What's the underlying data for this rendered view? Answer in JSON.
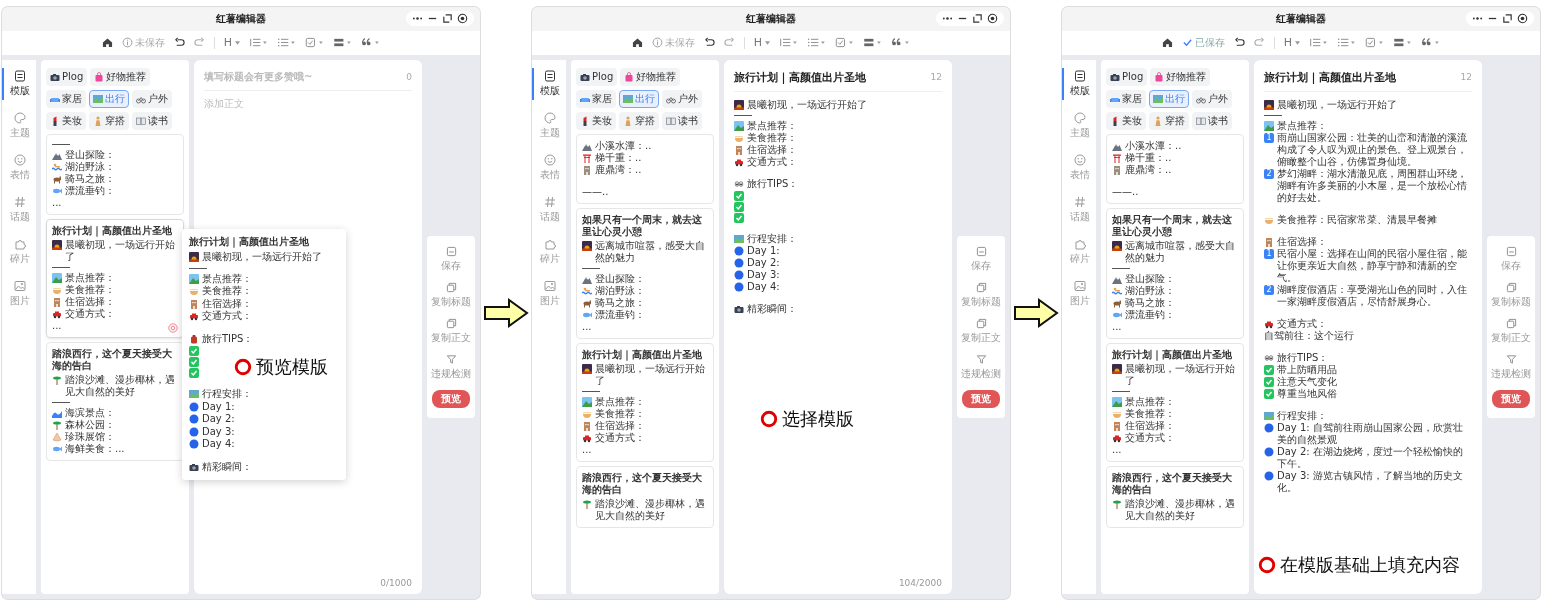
{
  "steps": [
    {
      "window_title": "红薯编辑器",
      "save_status": {
        "text": "未保存",
        "saved": false
      },
      "heading_label": "H",
      "nav": [
        {
          "label": "模版",
          "selected": true
        },
        {
          "label": "主题",
          "selected": false
        },
        {
          "label": "表情",
          "selected": false
        },
        {
          "label": "话题",
          "selected": false
        },
        {
          "label": "碎片",
          "selected": false
        },
        {
          "label": "图片",
          "selected": false
        }
      ],
      "category_rows": [
        [
          {
            "kind": "camera",
            "label": "Plog",
            "selected": false
          },
          {
            "kind": "shop",
            "label": "好物推荐",
            "selected": false
          }
        ],
        [
          {
            "kind": "sofa",
            "label": "家居",
            "selected": false
          },
          {
            "kind": "map",
            "label": "出行",
            "selected": true
          },
          {
            "kind": "bike",
            "label": "户外",
            "selected": false
          }
        ],
        [
          {
            "kind": "lipstick",
            "label": "美妆",
            "selected": false
          },
          {
            "kind": "person",
            "label": "穿搭",
            "selected": false
          },
          {
            "kind": "book",
            "label": "读书",
            "selected": false
          }
        ]
      ],
      "cards": [
        {
          "hovered": false,
          "lines": [
            {
              "kind": "rule"
            },
            {
              "kind": "hike",
              "text": "登山探险："
            },
            {
              "kind": "swim",
              "text": "湖泊野泳："
            },
            {
              "kind": "horse",
              "text": "骑马之旅："
            },
            {
              "kind": "fish",
              "text": "漂流垂钓："
            },
            {
              "kind": "plain",
              "text": "..."
            }
          ]
        },
        {
          "title": "旅行计划｜高颜值出片圣地",
          "hovered": true,
          "lines": [
            {
              "kind": "sunrise",
              "text": "晨曦初现，一场远行开始了"
            },
            {
              "kind": "rule"
            },
            {
              "kind": "scenery",
              "text": "景点推荐："
            },
            {
              "kind": "food",
              "text": "美食推荐："
            },
            {
              "kind": "hotel",
              "text": "住宿选择："
            },
            {
              "kind": "car",
              "text": "交通方式："
            },
            {
              "kind": "plain",
              "text": "..."
            }
          ]
        },
        {
          "title": "踏浪西行，这个夏天接受大海的告白",
          "hovered": false,
          "lines": [
            {
              "kind": "palm",
              "text": "踏浪沙滩、漫步椰林，遇见大自然的美好"
            },
            {
              "kind": "rule"
            },
            {
              "kind": "wave",
              "text": "海滨景点："
            },
            {
              "kind": "palm",
              "text": "森林公园："
            },
            {
              "kind": "shell",
              "text": "珍珠展馆："
            },
            {
              "kind": "fish",
              "text": "海鲜美食：..."
            }
          ]
        }
      ],
      "editor": {
        "title_placeholder": "填写标题会有更多赞哦~",
        "title_count": "0",
        "body_placeholder": "添加正文",
        "counter": "0/1000"
      },
      "preview": {
        "title": "旅行计划｜高颜值出片圣地",
        "lines": [
          {
            "kind": "sunrise",
            "text": "晨曦初现，一场远行开始了"
          },
          {
            "kind": "rule"
          },
          {
            "kind": "scenery",
            "text": "景点推荐："
          },
          {
            "kind": "food",
            "text": "美食推荐："
          },
          {
            "kind": "hotel",
            "text": "住宿选择："
          },
          {
            "kind": "car",
            "text": "交通方式："
          },
          {
            "kind": "blank"
          },
          {
            "kind": "bag",
            "text": "旅行TIPS："
          },
          {
            "kind": "check"
          },
          {
            "kind": "check"
          },
          {
            "kind": "check"
          },
          {
            "kind": "blank"
          },
          {
            "kind": "map",
            "text": "行程安排："
          },
          {
            "kind": "day",
            "text": "Day 1:"
          },
          {
            "kind": "day",
            "text": "Day 2:"
          },
          {
            "kind": "day",
            "text": "Day 3:"
          },
          {
            "kind": "day",
            "text": "Day 4:"
          },
          {
            "kind": "blank"
          },
          {
            "kind": "camera",
            "text": "精彩瞬间："
          }
        ]
      },
      "tools": [
        {
          "label": "保存"
        },
        {
          "label": "复制标题"
        },
        {
          "label": "复制正文"
        },
        {
          "label": "违规检测"
        }
      ],
      "preview_button": "预览",
      "annotation": "预览模版"
    },
    {
      "window_title": "红薯编辑器",
      "save_status": {
        "text": "未保存",
        "saved": false
      },
      "heading_label": "H",
      "nav": [
        {
          "label": "模版",
          "selected": true
        },
        {
          "label": "主题",
          "selected": false
        },
        {
          "label": "表情",
          "selected": false
        },
        {
          "label": "话题",
          "selected": false
        },
        {
          "label": "碎片",
          "selected": false
        },
        {
          "label": "图片",
          "selected": false
        }
      ],
      "category_rows": [
        [
          {
            "kind": "camera",
            "label": "Plog",
            "selected": false
          },
          {
            "kind": "shop",
            "label": "好物推荐",
            "selected": false
          }
        ],
        [
          {
            "kind": "sofa",
            "label": "家居",
            "selected": false
          },
          {
            "kind": "map",
            "label": "出行",
            "selected": true
          },
          {
            "kind": "bike",
            "label": "户外",
            "selected": false
          }
        ],
        [
          {
            "kind": "lipstick",
            "label": "美妆",
            "selected": false
          },
          {
            "kind": "person",
            "label": "穿搭",
            "selected": false
          },
          {
            "kind": "book",
            "label": "读书",
            "selected": false
          }
        ]
      ],
      "cards": [
        {
          "hovered": false,
          "lines": [
            {
              "kind": "hike",
              "text": "小溪水潭：.."
            },
            {
              "kind": "gate",
              "text": "梯千重：.."
            },
            {
              "kind": "temple",
              "text": "鹿鼎湾：.."
            },
            {
              "kind": "blank"
            },
            {
              "kind": "plain",
              "text": "——.."
            }
          ]
        },
        {
          "title": "如果只有一个周末，就去这里让心灵小憩",
          "hovered": false,
          "lines": [
            {
              "kind": "sunrise",
              "text": "远离城市喧嚣，感受大自然的魅力"
            },
            {
              "kind": "rule"
            },
            {
              "kind": "hike",
              "text": "登山探险："
            },
            {
              "kind": "swim",
              "text": "湖泊野泳："
            },
            {
              "kind": "horse",
              "text": "骑马之旅："
            },
            {
              "kind": "fish",
              "text": "漂流垂钓："
            },
            {
              "kind": "plain",
              "text": "..."
            }
          ]
        },
        {
          "title": "旅行计划｜高颜值出片圣地",
          "hovered": false,
          "lines": [
            {
              "kind": "sunrise",
              "text": "晨曦初现，一场远行开始了"
            },
            {
              "kind": "rule"
            },
            {
              "kind": "scenery",
              "text": "景点推荐："
            },
            {
              "kind": "food",
              "text": "美食推荐："
            },
            {
              "kind": "hotel",
              "text": "住宿选择："
            },
            {
              "kind": "car",
              "text": "交通方式："
            },
            {
              "kind": "plain",
              "text": "..."
            }
          ]
        },
        {
          "title": "踏浪西行，这个夏天接受大海的告白",
          "hovered": false,
          "lines": [
            {
              "kind": "palm",
              "text": "踏浪沙滩、漫步椰林，遇见大自然的美好"
            }
          ]
        }
      ],
      "editor": {
        "title": "旅行计划｜高颜值出片圣地",
        "title_count": "12",
        "counter": "104/2000",
        "body": [
          {
            "kind": "sunrise",
            "text": "晨曦初现，一场远行开始了"
          },
          {
            "kind": "rule"
          },
          {
            "kind": "scenery",
            "text": "景点推荐："
          },
          {
            "kind": "food",
            "text": "美食推荐："
          },
          {
            "kind": "hotel",
            "text": "住宿选择："
          },
          {
            "kind": "car",
            "text": "交通方式："
          },
          {
            "kind": "blank"
          },
          {
            "kind": "eyes",
            "text": "旅行TIPS："
          },
          {
            "kind": "check"
          },
          {
            "kind": "check"
          },
          {
            "kind": "check"
          },
          {
            "kind": "blank"
          },
          {
            "kind": "map",
            "text": "行程安排："
          },
          {
            "kind": "day",
            "text": "Day 1:"
          },
          {
            "kind": "day",
            "text": "Day 2:"
          },
          {
            "kind": "day",
            "text": "Day 3:"
          },
          {
            "kind": "day",
            "text": "Day 4:"
          },
          {
            "kind": "blank"
          },
          {
            "kind": "camera",
            "text": "精彩瞬间："
          }
        ]
      },
      "tools": [
        {
          "label": "保存"
        },
        {
          "label": "复制标题"
        },
        {
          "label": "复制正文"
        },
        {
          "label": "违规检测"
        }
      ],
      "preview_button": "预览",
      "annotation": "选择模版"
    },
    {
      "window_title": "红薯编辑器",
      "save_status": {
        "text": "已保存",
        "saved": true
      },
      "heading_label": "H",
      "nav": [
        {
          "label": "模版",
          "selected": true
        },
        {
          "label": "主题",
          "selected": false
        },
        {
          "label": "表情",
          "selected": false
        },
        {
          "label": "话题",
          "selected": false
        },
        {
          "label": "碎片",
          "selected": false
        },
        {
          "label": "图片",
          "selected": false
        }
      ],
      "category_rows": [
        [
          {
            "kind": "camera",
            "label": "Plog",
            "selected": false
          },
          {
            "kind": "shop",
            "label": "好物推荐",
            "selected": false
          }
        ],
        [
          {
            "kind": "sofa",
            "label": "家居",
            "selected": false
          },
          {
            "kind": "map",
            "label": "出行",
            "selected": true
          },
          {
            "kind": "bike",
            "label": "户外",
            "selected": false
          }
        ],
        [
          {
            "kind": "lipstick",
            "label": "美妆",
            "selected": false
          },
          {
            "kind": "person",
            "label": "穿搭",
            "selected": false
          },
          {
            "kind": "book",
            "label": "读书",
            "selected": false
          }
        ]
      ],
      "cards": [
        {
          "hovered": false,
          "lines": [
            {
              "kind": "hike",
              "text": "小溪水潭：.."
            },
            {
              "kind": "gate",
              "text": "梯千重：.."
            },
            {
              "kind": "temple",
              "text": "鹿鼎湾：.."
            },
            {
              "kind": "blank"
            },
            {
              "kind": "plain",
              "text": "——.."
            }
          ]
        },
        {
          "title": "如果只有一个周末，就去这里让心灵小憩",
          "hovered": false,
          "lines": [
            {
              "kind": "sunrise",
              "text": "远离城市喧嚣，感受大自然的魅力"
            },
            {
              "kind": "rule"
            },
            {
              "kind": "hike",
              "text": "登山探险："
            },
            {
              "kind": "swim",
              "text": "湖泊野泳："
            },
            {
              "kind": "horse",
              "text": "骑马之旅："
            },
            {
              "kind": "fish",
              "text": "漂流垂钓："
            },
            {
              "kind": "plain",
              "text": "..."
            }
          ]
        },
        {
          "title": "旅行计划｜高颜值出片圣地",
          "hovered": false,
          "lines": [
            {
              "kind": "sunrise",
              "text": "晨曦初现，一场远行开始了"
            },
            {
              "kind": "rule"
            },
            {
              "kind": "scenery",
              "text": "景点推荐："
            },
            {
              "kind": "food",
              "text": "美食推荐："
            },
            {
              "kind": "hotel",
              "text": "住宿选择："
            },
            {
              "kind": "car",
              "text": "交通方式："
            },
            {
              "kind": "plain",
              "text": "..."
            }
          ]
        },
        {
          "title": "踏浪西行，这个夏天接受大海的告白",
          "hovered": false,
          "lines": [
            {
              "kind": "palm",
              "text": "踏浪沙滩、漫步椰林，遇见大自然的美好"
            }
          ]
        }
      ],
      "editor": {
        "title": "旅行计划｜高颜值出片圣地",
        "title_count": "12",
        "body": [
          {
            "kind": "sunrise",
            "text": "晨曦初现，一场远行开始了"
          },
          {
            "kind": "rule"
          },
          {
            "kind": "scenery",
            "text": "景点推荐："
          },
          {
            "kind": "num",
            "badge": "1",
            "text": "雨崩山国家公园：壮美的山峦和清澈的溪流构成了令人叹为观止的景色。登上观景台，俯瞰整个山谷，仿佛置身仙境。"
          },
          {
            "kind": "num",
            "badge": "2",
            "text": "梦幻湖畔：湖水清澈见底，周围群山环绕，湖畔有许多美丽的小木屋，是一个放松心情的好去处。"
          },
          {
            "kind": "blank"
          },
          {
            "kind": "food",
            "text": "美食推荐：民宿家常菜、清晨早餐摊"
          },
          {
            "kind": "blank"
          },
          {
            "kind": "hotel",
            "text": "住宿选择："
          },
          {
            "kind": "num",
            "badge": "1",
            "text": "民宿小屋：选择在山间的民宿小屋住宿，能让你更亲近大自然，静享宁静和清新的空气。"
          },
          {
            "kind": "num",
            "badge": "2",
            "text": "湖畔度假酒店：享受湖光山色的同时，入住一家湖畔度假酒店，尽情舒展身心。"
          },
          {
            "kind": "blank"
          },
          {
            "kind": "car",
            "text": "交通方式："
          },
          {
            "kind": "plain",
            "text": "自驾前往：这个运行"
          },
          {
            "kind": "blank"
          },
          {
            "kind": "eyes",
            "text": "旅行TIPS："
          },
          {
            "kind": "check",
            "text": "带上防晒用品"
          },
          {
            "kind": "check",
            "text": "注意天气变化"
          },
          {
            "kind": "check",
            "text": "尊重当地风俗"
          },
          {
            "kind": "blank"
          },
          {
            "kind": "map",
            "text": "行程安排："
          },
          {
            "kind": "day",
            "text": "Day 1: 自驾前往雨崩山国家公园，欣赏壮美的自然景观"
          },
          {
            "kind": "day",
            "text": "Day 2: 在湖边烧烤，度过一个轻松愉快的下午。"
          },
          {
            "kind": "day",
            "text": "Day 3: 游览古镇风情，了解当地的历史文化。"
          }
        ]
      },
      "tools": [
        {
          "label": "保存"
        },
        {
          "label": "复制标题"
        },
        {
          "label": "复制正文"
        },
        {
          "label": "违规检测"
        }
      ],
      "preview_button": "预览",
      "annotation": "在模版基础上填充内容"
    }
  ]
}
